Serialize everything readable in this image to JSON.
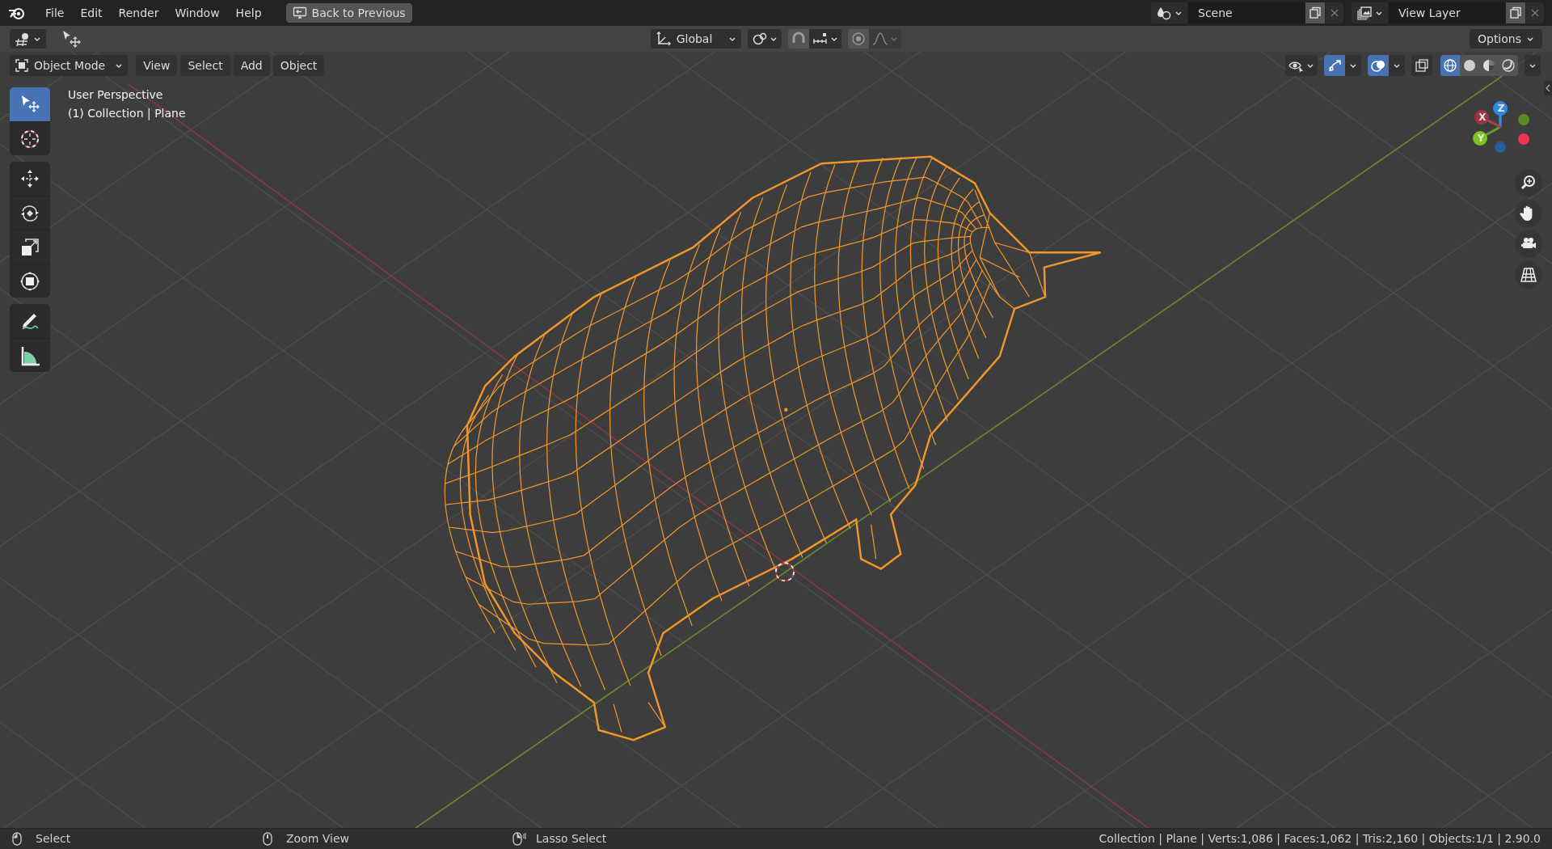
{
  "menu": [
    {
      "label": "File"
    },
    {
      "label": "Edit"
    },
    {
      "label": "Render"
    },
    {
      "label": "Window"
    },
    {
      "label": "Help"
    }
  ],
  "back_button": "Back to Previous",
  "scene": {
    "name": "Scene"
  },
  "view_layer": {
    "name": "View Layer"
  },
  "tool_header": {
    "orientation": "Global",
    "options": "Options",
    "snap_on": false,
    "proportional_on": false
  },
  "viewport_header": {
    "mode": "Object Mode",
    "menus": [
      "View",
      "Select",
      "Add",
      "Object"
    ]
  },
  "toggles": [
    {
      "kind": "gizmos",
      "on": true
    },
    {
      "kind": "overlays",
      "on": true
    },
    {
      "kind": "xray",
      "on": false
    }
  ],
  "shading": [
    {
      "kind": "wireframe",
      "selected": true
    },
    {
      "kind": "solid",
      "selected": false
    },
    {
      "kind": "material",
      "selected": false
    },
    {
      "kind": "rendered",
      "selected": false
    }
  ],
  "tool_groups": [
    {
      "tools": [
        {
          "kind": "select",
          "selected": true
        },
        {
          "kind": "cursor",
          "selected": false
        }
      ]
    },
    {
      "tools": [
        {
          "kind": "move",
          "selected": false
        },
        {
          "kind": "rotate",
          "selected": false
        },
        {
          "kind": "scale",
          "selected": false
        },
        {
          "kind": "transform",
          "selected": false
        }
      ]
    },
    {
      "tools": [
        {
          "kind": "annotate",
          "selected": false
        },
        {
          "kind": "measure",
          "selected": false
        }
      ]
    }
  ],
  "overlay_text": [
    "User Perspective",
    "(1) Collection | Plane"
  ],
  "gizmo": {
    "x": "X",
    "y": "Y",
    "z": "Z"
  },
  "status_bar": {
    "hints": [
      {
        "kind": "left",
        "label": "Select"
      },
      {
        "kind": "middle",
        "label": "Zoom View"
      },
      {
        "kind": "right",
        "label": "Lasso Select"
      }
    ],
    "stats": "Collection | Plane | Verts:1,086 | Faces:1,062 | Tris:2,160 | Objects:1/1 | 2.90.0"
  }
}
